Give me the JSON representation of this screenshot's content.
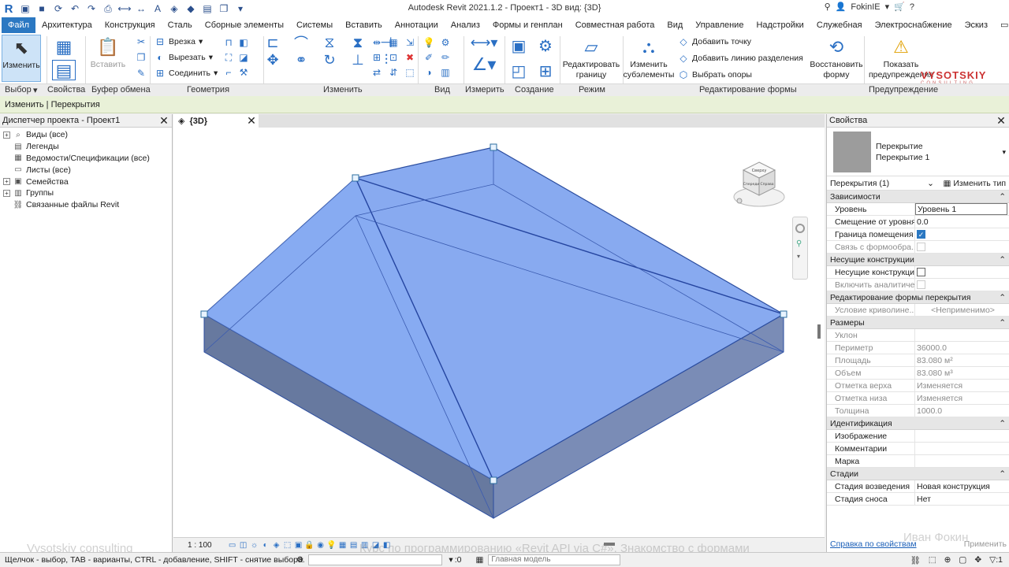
{
  "window": {
    "title": "Autodesk Revit 2021.1.2 - Проект1 - 3D вид: {3D}",
    "user": "FokinIE"
  },
  "ribbon_tabs": [
    "Файл",
    "Архитектура",
    "Конструкция",
    "Сталь",
    "Сборные элементы",
    "Системы",
    "Вставить",
    "Аннотации",
    "Анализ",
    "Формы и генплан",
    "Совместная работа",
    "Вид",
    "Управление",
    "Надстройки",
    "Служебная",
    "Электроснабжение",
    "Эскиз"
  ],
  "ribbon": {
    "modify": "Изменить",
    "paste": "Вставить",
    "cut_join": "Врезка",
    "cut": "Вырезать",
    "join": "Соединить",
    "edit_boundary": "Редактировать\nграницу",
    "modify_subelements": "Изменить\nсубэлементы",
    "add_point": "Добавить точку",
    "add_split_line": "Добавить линию разделения",
    "pick_supports": "Выбрать опоры",
    "reset_shape": "Восстановить\nформу",
    "show_warnings": "Показать\nпредупреждения",
    "panels": {
      "select": "Выбор",
      "properties": "Свойства",
      "clipboard": "Буфер обмена",
      "geometry": "Геометрия",
      "modify": "Изменить",
      "view": "Вид",
      "measure": "Измерить",
      "create": "Создание",
      "mode": "Режим",
      "shape_editing": "Редактирование формы",
      "warning": "Предупреждение"
    }
  },
  "context_bar": "Изменить | Перекрытия",
  "project_browser": {
    "title": "Диспетчер проекта - Проект1",
    "items": [
      {
        "label": "Виды (все)",
        "icon": "views-icon",
        "expander": true
      },
      {
        "label": "Легенды",
        "icon": "legend-icon",
        "expander": false
      },
      {
        "label": "Ведомости/Спецификации (все)",
        "icon": "schedule-icon",
        "expander": false
      },
      {
        "label": "Листы (все)",
        "icon": "sheet-icon",
        "expander": false
      },
      {
        "label": "Семейства",
        "icon": "family-icon",
        "expander": true
      },
      {
        "label": "Группы",
        "icon": "group-icon",
        "expander": true
      },
      {
        "label": "Связанные файлы Revit",
        "icon": "link-icon",
        "expander": false
      }
    ]
  },
  "view": {
    "tab_label": "{3D}",
    "scale": "1 : 100",
    "viewcube_labels": [
      "Сверху",
      "Спереди",
      "Справа"
    ]
  },
  "properties": {
    "title": "Свойства",
    "family": "Перекрытие",
    "type": "Перекрытие 1",
    "instance_filter": "Перекрытия (1)",
    "edit_type": "Изменить тип",
    "groups": [
      {
        "name": "Зависимости",
        "rows": [
          {
            "key": "Уровень",
            "value": "Уровень 1",
            "kind": "input"
          },
          {
            "key": "Смещение от уровня",
            "value": "0.0",
            "kind": "text"
          },
          {
            "key": "Граница помещения",
            "value": "",
            "kind": "check-on"
          },
          {
            "key": "Связь с формообра...",
            "value": "",
            "kind": "check-dis"
          }
        ]
      },
      {
        "name": "Несущие конструкции",
        "rows": [
          {
            "key": "Несущие конструкции",
            "value": "",
            "kind": "check-off"
          },
          {
            "key": "Включить аналитиче...",
            "value": "",
            "kind": "check-dis"
          }
        ]
      },
      {
        "name": "Редактирование формы перекрытия",
        "rows": [
          {
            "key": "Условие криволине...",
            "value": "<Неприменимо>",
            "kind": "disabled"
          }
        ]
      },
      {
        "name": "Размеры",
        "rows": [
          {
            "key": "Уклон",
            "value": "",
            "kind": "disabled"
          },
          {
            "key": "Периметр",
            "value": "36000.0",
            "kind": "disabled"
          },
          {
            "key": "Площадь",
            "value": "83.080 м²",
            "kind": "disabled"
          },
          {
            "key": "Объем",
            "value": "83.080 м³",
            "kind": "disabled"
          },
          {
            "key": "Отметка верха",
            "value": "Изменяется",
            "kind": "disabled"
          },
          {
            "key": "Отметка низа",
            "value": "Изменяется",
            "kind": "disabled"
          },
          {
            "key": "Толщина",
            "value": "1000.0",
            "kind": "disabled"
          }
        ]
      },
      {
        "name": "Идентификация",
        "rows": [
          {
            "key": "Изображение",
            "value": "",
            "kind": "text"
          },
          {
            "key": "Комментарии",
            "value": "",
            "kind": "text"
          },
          {
            "key": "Марка",
            "value": "",
            "kind": "text"
          }
        ]
      },
      {
        "name": "Стадии",
        "rows": [
          {
            "key": "Стадия возведения",
            "value": "Новая конструкция",
            "kind": "text"
          },
          {
            "key": "Стадия сноса",
            "value": "Нет",
            "kind": "text"
          }
        ]
      }
    ],
    "help_link": "Справка по свойствам",
    "apply": "Применить"
  },
  "status": {
    "hint": "Щелчок - выбор, TAB - варианты, CTRL - добавление, SHIFT - снятие выбора.",
    "selection_count": ":0",
    "model": "Главная модель"
  },
  "brand": {
    "name": "VYSOTSKIY",
    "sub": "CONSULTING"
  },
  "overlays": {
    "left": "Vysotskiy consulting",
    "center": "Курс по программированию «Revit API via C#». Знакомство с формами ",
    "right": "Иван Фокин"
  },
  "colors": {
    "accent": "#2b78c2",
    "slab_top": "#7fa6ee",
    "slab_side": "#5a6f94",
    "context_bar": "#e9f1d8"
  }
}
